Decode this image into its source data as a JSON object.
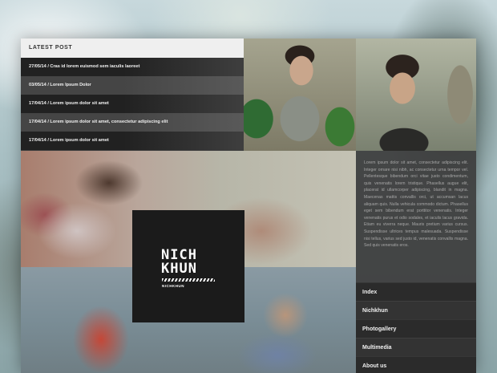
{
  "latest_post": {
    "header": "LATEST POST",
    "posts": [
      "27/05/14 / Cras id lorem euismod sem iaculis laoreet",
      "03/05/14 / Lorem Ipsum Dolor",
      "17/04/14 / Lorem ipsum dolor sit amet",
      "17/04/14 / Lorem ipsum dolor sit amet, consectetur adipiscing elit",
      "17/04/14 / Lorem ipsum dolor sit amet"
    ]
  },
  "logo": {
    "line1": "NICH",
    "line2": "KHUN",
    "sub": "NICHKHUN"
  },
  "sidebar": {
    "about_text": "Lorem ipsum dolor sit amet, consectetur adipiscing elit. Integer ornare nisi nibh, ac consectetur urna tempor vel. Pellentesque bibendum orci vitae justo condimentum, quis venenatis lorem tristique. Phasellus augue elit, placerat id ullamcorper adipiscing, blandit in magna. Maecenas mattis convallis orci, ut accumsan lacus aliquam quis. Nulla vehicula commodo dictum. Phasellus eget sem bibendum erat porttitor venenatis. Integer venenatis purus et odio sodales, et iaculis lacus gravida. Etiam eu viverra neque. Mauris pretium varius cursus. Suspendisse ultrices tempus malesuada. Suspendisse nisi tellus, varius sed justo id, venenatis convallis magna. Sed quis venenatis eros.",
    "nav": [
      "Index",
      "Nichkhun",
      "Photogallery",
      "Multimedia",
      "About us"
    ]
  }
}
